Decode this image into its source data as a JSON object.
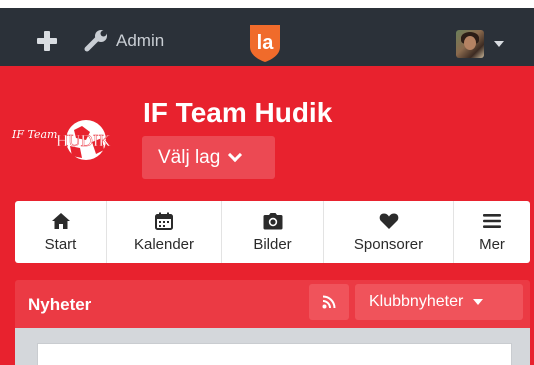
{
  "topbar": {
    "add_icon": "plus-icon",
    "admin_label": "Admin",
    "admin_icon": "wrench-icon",
    "logo_text": "la",
    "logo_color": "#f06b2b",
    "user_menu_icon": "caret-down-icon"
  },
  "club": {
    "name": "IF Team Hudik",
    "logo_text_line1": "IF Team",
    "logo_text_line2": "HUDIK",
    "team_select_label": "Välj lag"
  },
  "menu": {
    "items": [
      {
        "label": "Start",
        "icon": "home-icon"
      },
      {
        "label": "Kalender",
        "icon": "calendar-icon"
      },
      {
        "label": "Bilder",
        "icon": "camera-icon"
      },
      {
        "label": "Sponsorer",
        "icon": "heart-icon"
      },
      {
        "label": "Mer",
        "icon": "hamburger-icon"
      }
    ]
  },
  "news": {
    "title": "Nyheter",
    "rss_icon": "rss-icon",
    "filter_label": "Klubbnyheter"
  },
  "colors": {
    "brand_red": "#e8222e",
    "appbar": "#2b3139",
    "button_red": "#eb3a44"
  }
}
